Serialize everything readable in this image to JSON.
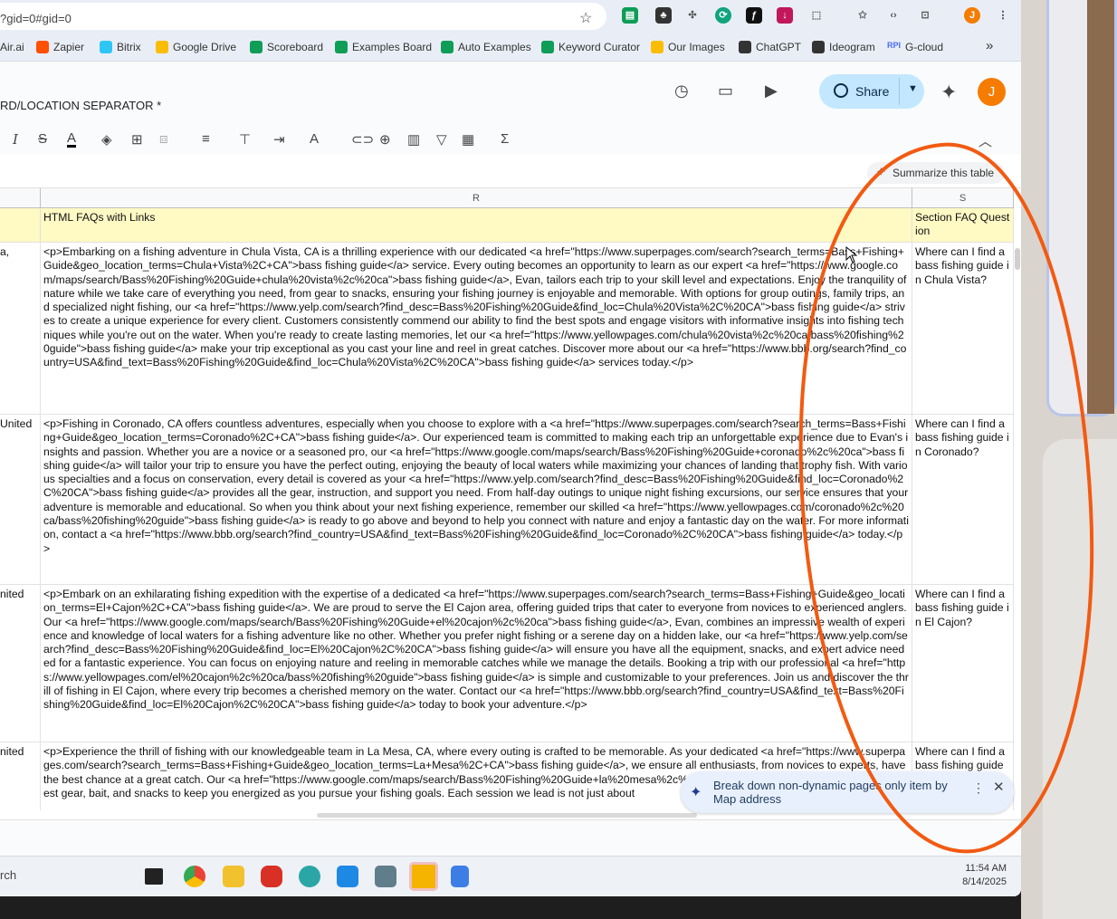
{
  "browser": {
    "url_fragment": "?gid=0#gid=0",
    "bookmarks": [
      {
        "label": "Air.ai",
        "color": "#777777"
      },
      {
        "label": "Zapier",
        "color": "#ff4f00"
      },
      {
        "label": "Bitrix",
        "color": "#2fc6f6"
      },
      {
        "label": "Google Drive",
        "color": "#fbbc04"
      },
      {
        "label": "Scoreboard",
        "color": "#0f9d58"
      },
      {
        "label": "Examples Board",
        "color": "#0f9d58"
      },
      {
        "label": "Auto Examples",
        "color": "#0f9d58"
      },
      {
        "label": "Keyword Curator",
        "color": "#0f9d58"
      },
      {
        "label": "Our Images",
        "color": "#fbbc04"
      },
      {
        "label": "ChatGPT",
        "color": "#333333"
      },
      {
        "label": "Ideogram",
        "color": "#333333"
      },
      {
        "label": "G-cloud",
        "color": "#4a6cf7"
      }
    ],
    "g_cloud_prefix": "RPI",
    "more_bookmarks": "»",
    "profile_initial": "J"
  },
  "sheet": {
    "title": "RD/LOCATION SEPARATOR *",
    "share_label": "Share",
    "user_initial": "J",
    "summarize_label": "Summarize this table",
    "columns": [
      {
        "letter": "",
        "key": "Q"
      },
      {
        "letter": "R",
        "key": "R"
      },
      {
        "letter": "S",
        "key": "S"
      }
    ],
    "header_row": {
      "q": "",
      "r": "HTML FAQs with Links",
      "s": "Section FAQ Question"
    },
    "rows": [
      {
        "q": "a,",
        "r": "<p>Embarking on a fishing adventure in Chula Vista, CA is a thrilling experience with our dedicated <a href=\"https://www.superpages.com/search?search_terms=Bass+Fishing+Guide&geo_location_terms=Chula+Vista%2C+CA\">bass fishing guide</a> service. Every outing becomes an opportunity to learn as our expert <a href=\"https://www.google.com/maps/search/Bass%20Fishing%20Guide+chula%20vista%2c%20ca\">bass fishing guide</a>, Evan, tailors each trip to your skill level and expectations. Enjoy the tranquility of nature while we take care of everything you need, from gear to snacks, ensuring your fishing journey is enjoyable and memorable. With options for group outings, family trips, and specialized night fishing, our <a href=\"https://www.yelp.com/search?find_desc=Bass%20Fishing%20Guide&find_loc=Chula%20Vista%2C%20CA\">bass fishing guide</a> strives to create a unique experience for every client. Customers consistently commend our ability to find the best spots and engage visitors with informative insights into fishing techniques while you're out on the water. When you're ready to create lasting memories, let our <a href=\"https://www.yellowpages.com/chula%20vista%2c%20ca/bass%20fishing%20guide\">bass fishing guide</a> make your trip exceptional as you cast your line and reel in great catches. Discover more about our <a href=\"https://www.bbb.org/search?find_country=USA&find_text=Bass%20Fishing%20Guide&find_loc=Chula%20Vista%2C%20CA\">bass fishing guide</a> services today.</p>",
        "s": "Where can I find a bass fishing guide in Chula Vista?"
      },
      {
        "q": "United",
        "r": "<p>Fishing in Coronado, CA offers countless adventures, especially when you choose to explore with a <a href=\"https://www.superpages.com/search?search_terms=Bass+Fishing+Guide&geo_location_terms=Coronado%2C+CA\">bass fishing guide</a>. Our experienced team is committed to making each trip an unforgettable experience due to Evan's insights and passion. Whether you are a novice or a seasoned pro, our <a href=\"https://www.google.com/maps/search/Bass%20Fishing%20Guide+coronado%2c%20ca\">bass fishing guide</a> will tailor your trip to ensure you have the perfect outing, enjoying the beauty of local waters while maximizing your chances of landing that trophy fish. With various specialties and a focus on conservation, every detail is covered as your <a href=\"https://www.yelp.com/search?find_desc=Bass%20Fishing%20Guide&find_loc=Coronado%2C%20CA\">bass fishing guide</a> provides all the gear, instruction, and support you need. From half-day outings to unique night fishing excursions, our service ensures that your adventure is memorable and educational. So when you think about your next fishing experience, remember our skilled <a href=\"https://www.yellowpages.com/coronado%2c%20ca/bass%20fishing%20guide\">bass fishing guide</a> is ready to go above and beyond to help you connect with nature and enjoy a fantastic day on the water. For more information, contact a <a href=\"https://www.bbb.org/search?find_country=USA&find_text=Bass%20Fishing%20Guide&find_loc=Coronado%2C%20CA\">bass fishing guide</a> today.</p>",
        "s": "Where can I find a bass fishing guide in Coronado?"
      },
      {
        "q": "nited",
        "r": "<p>Embark on an exhilarating fishing expedition with the expertise of a dedicated <a href=\"https://www.superpages.com/search?search_terms=Bass+Fishing+Guide&geo_location_terms=El+Cajon%2C+CA\">bass fishing guide</a>. We are proud to serve the El Cajon area, offering guided trips that cater to everyone from novices to experienced anglers. Our <a href=\"https://www.google.com/maps/search/Bass%20Fishing%20Guide+el%20cajon%2c%20ca\">bass fishing guide</a>, Evan, combines an impressive wealth of experience and knowledge of local waters for a fishing adventure like no other. Whether you prefer night fishing or a serene day on a hidden lake, our <a href=\"https://www.yelp.com/search?find_desc=Bass%20Fishing%20Guide&find_loc=El%20Cajon%2C%20CA\">bass fishing guide</a> will ensure you have all the equipment, snacks, and expert advice needed for a fantastic experience. You can focus on enjoying nature and reeling in memorable catches while we manage the details. Booking a trip with our professional <a href=\"https://www.yellowpages.com/el%20cajon%2c%20ca/bass%20fishing%20guide\">bass fishing guide</a> is simple and customizable to your preferences. Join us and discover the thrill of fishing in El Cajon, where every trip becomes a cherished memory on the water. Contact our <a href=\"https://www.bbb.org/search?find_country=USA&find_text=Bass%20Fishing%20Guide&find_loc=El%20Cajon%2C%20CA\">bass fishing guide</a> today to book your adventure.</p>",
        "s": "Where can I find a bass fishing guide in El Cajon?"
      },
      {
        "q": "nited",
        "r": "<p>Experience the thrill of fishing with our knowledgeable team in La Mesa, CA, where every outing is crafted to be memorable. As your dedicated <a href=\"https://www.superpages.com/search?search_terms=Bass+Fishing+Guide&geo_location_terms=La+Mesa%2C+CA\">bass fishing guide</a>, we ensure all enthusiasts, from novices to experts, have the best chance at a great catch. Our <a href=\"https://www.google.com/maps/search/Bass%20Fishing%20Guide+la%20mesa%2c%20ca\">bass fishing guide</a> service the finest gear, bait, and snacks to keep you energized as you pursue your fishing goals. Each session we lead is not just about",
        "s": "Where can I find a bass fishing guide"
      }
    ]
  },
  "toast": {
    "message": "Break down non-dynamic pages only item by Map address",
    "more_label": "⋮",
    "close_label": "✕"
  },
  "taskbar": {
    "search_stub": "rch",
    "time": "11:54 AM",
    "date": "8/14/2025"
  },
  "accent_colors": {
    "annotation": "#f25a12",
    "share_bg": "#c2e7ff",
    "avatar": "#f57c00",
    "header_row_bg": "#fff9c4"
  }
}
